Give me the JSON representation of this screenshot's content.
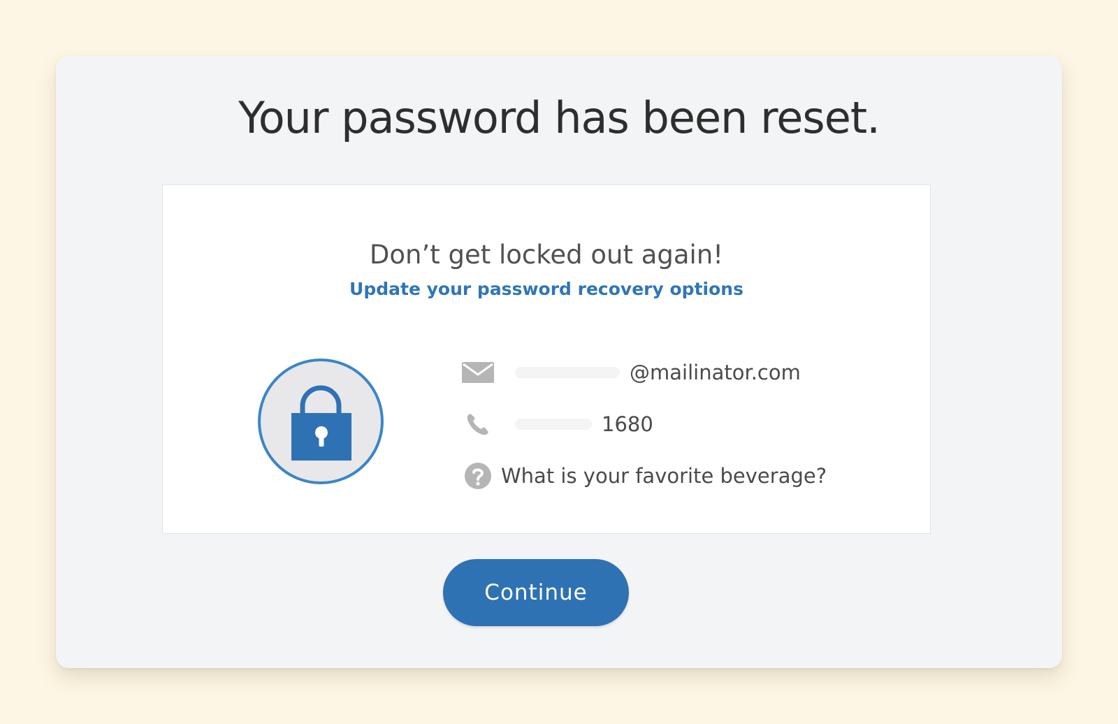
{
  "page": {
    "title": "Your password has been reset."
  },
  "card": {
    "subheading": "Don’t get locked out again!",
    "link_label": "Update your password recovery options",
    "lock_icon": "padlock-icon",
    "recovery_options": [
      {
        "icon": "envelope-icon",
        "value": "@mailinator.com"
      },
      {
        "icon": "phone-icon",
        "value": "1680"
      },
      {
        "icon": "question-mark-icon",
        "value": "What is your favorite beverage?"
      }
    ]
  },
  "actions": {
    "continue_label": "Continue"
  },
  "colors": {
    "page_background": "#fdf6e4",
    "accent": "#2f72b4",
    "link": "#2f76b7",
    "icon_gray": "#b5b5b5"
  }
}
